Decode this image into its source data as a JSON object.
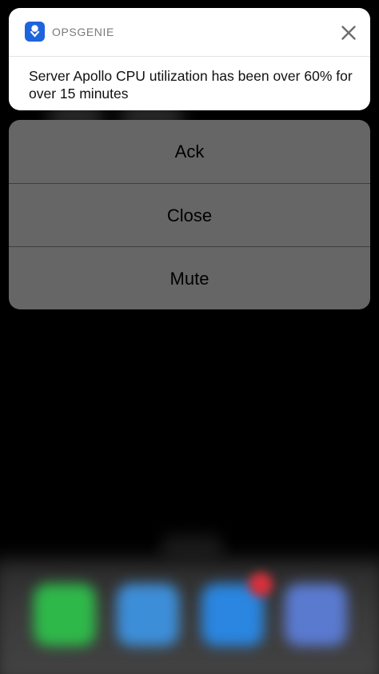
{
  "notification": {
    "app_name": "OPSGENIE",
    "app_icon": "opsgenie-logo-icon",
    "close_icon": "close-icon",
    "message": "Server Apollo CPU utilization has been over 60% for over 15 minutes"
  },
  "actions": [
    {
      "label": "Ack"
    },
    {
      "label": "Close"
    },
    {
      "label": "Mute"
    }
  ],
  "colors": {
    "app_icon_bg": "#1e64dc",
    "action_sheet_bg": "#666666",
    "badge": "#d9303a"
  }
}
